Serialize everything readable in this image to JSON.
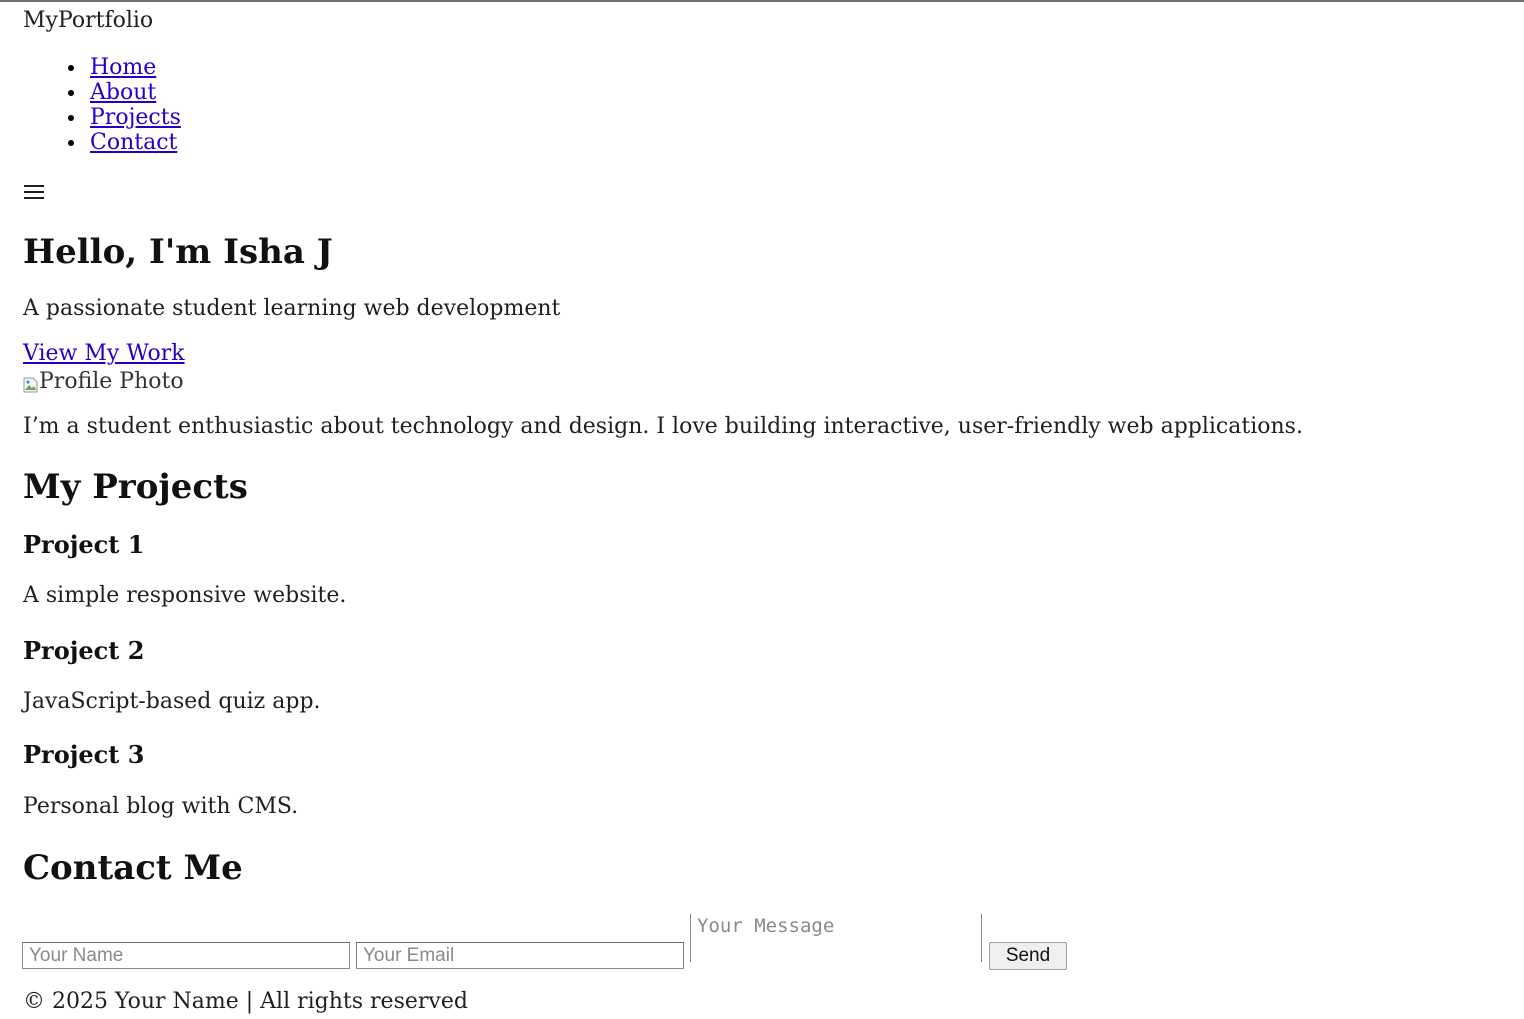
{
  "header": {
    "brand": "MyPortfolio",
    "nav": [
      "Home",
      "About",
      "Projects",
      "Contact"
    ],
    "menu_icon": "hamburger-menu-icon"
  },
  "hero": {
    "title": "Hello, I'm Isha J",
    "subtitle": "A passionate student learning web development",
    "cta_label": "View My Work",
    "photo_alt": "Profile Photo",
    "photo_icon": "broken-image-icon"
  },
  "about": {
    "text": "I’m a student enthusiastic about technology and design. I love building interactive, user-friendly web applications."
  },
  "projects": {
    "heading": "My Projects",
    "items": [
      {
        "title": "Project 1",
        "description": "A simple responsive website."
      },
      {
        "title": "Project 2",
        "description": "JavaScript-based quiz app."
      },
      {
        "title": "Project 3",
        "description": "Personal blog with CMS."
      }
    ]
  },
  "contact": {
    "heading": "Contact Me",
    "name_placeholder": "Your Name",
    "email_placeholder": "Your Email",
    "message_placeholder": "Your Message",
    "send_label": "Send"
  },
  "footer": {
    "text": "© 2025 Your Name | All rights reserved"
  },
  "colors": {
    "link": "#2200cc",
    "text": "#1f1f1f",
    "placeholder": "#8a8a8a"
  }
}
